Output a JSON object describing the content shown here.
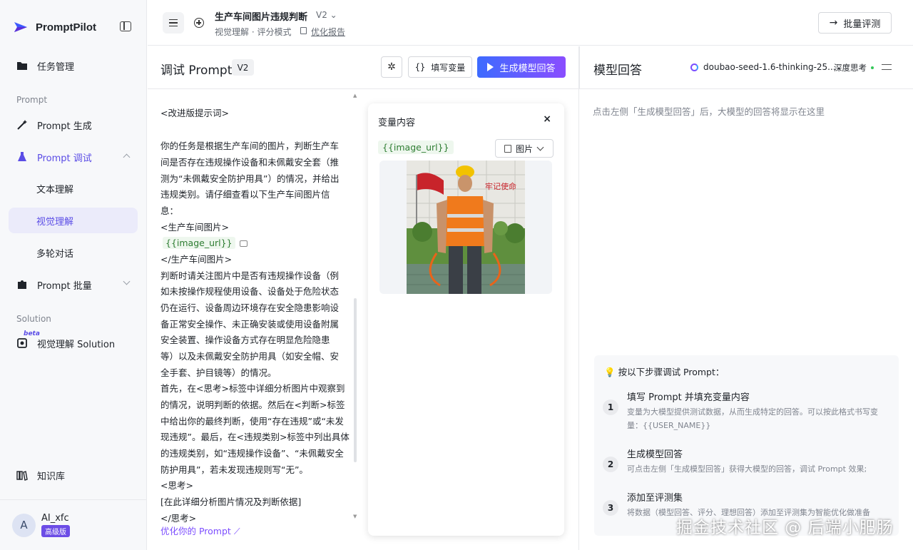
{
  "brand": {
    "name": "PromptPilot"
  },
  "sidebar": {
    "task_mgmt": "任务管理",
    "section_prompt": "Prompt",
    "prompt_gen": "Prompt 生成",
    "prompt_debug": "Prompt 调试",
    "sub_text": "文本理解",
    "sub_vision": "视觉理解",
    "sub_multi": "多轮对话",
    "prompt_batch": "Prompt 批量",
    "section_solution": "Solution",
    "beta": "beta",
    "vision_solution": "视觉理解 Solution",
    "knowledge": "知识库",
    "user": {
      "initial": "A",
      "name": "AI_xfc",
      "plan": "高级版"
    }
  },
  "header": {
    "title": "生产车间图片违规判断",
    "version": "V2 ⌄",
    "subtitle": "视觉理解 · 评分模式",
    "report_link": "优化报告",
    "batch_eval": "批量评测"
  },
  "debug": {
    "title": "调试 Prompt",
    "version_badge": "V2",
    "fill_vars": "填写变量",
    "generate": "生成模型回答"
  },
  "prompt_lines": [
    "<改进版提示词>",
    "",
    "你的任务是根据生产车间的图片，判断生产车",
    "间是否存在违规操作设备和未佩戴安全套（推",
    "测为“未佩戴安全防护用具”）的情况，并给出",
    "违规类别。请仔细查看以下生产车间图片信",
    "息：",
    "<生产车间图片>",
    "{{image_url}}",
    "</生产车间图片>",
    "判断时请关注图片中是否有违规操作设备（例",
    "如未按操作规程使用设备、设备处于危险状态",
    "仍在运行、设备周边环境存在安全隐患影响设",
    "备正常安全操作、未正确安装或使用设备附属",
    "安全装置、操作设备方式存在明显危险隐患",
    "等）以及未佩戴安全防护用具（如安全帽、安",
    "全手套、护目镜等）的情况。",
    "首先，在<思考>标签中详细分析图片中观察到",
    "的情况，说明判断的依据。然后在<判断>标签",
    "中给出你的最终判断，使用“存在违规”或“未发",
    "现违规”。最后，在<违规类别>标签中列出具体",
    "的违规类别，如“违规操作设备”、“未佩戴安全",
    "防护用具”，若未发现违规则写“无”。",
    "<思考>",
    "[在此详细分析图片情况及判断依据]",
    "</思考>"
  ],
  "optimize_link": "优化你的 Prompt",
  "var_panel": {
    "title": "变量内容",
    "close": "×",
    "var_name": "{{image_url}}",
    "type": "图片",
    "poster_text": "牢记使命"
  },
  "answer": {
    "title": "模型回答",
    "model": "doubao-seed-1.6-thinking-25...",
    "deep_think": "深度思考",
    "hint": "点击左侧「生成模型回答」后，大模型的回答将显示在这里"
  },
  "steps": {
    "title": "按以下步骤调试 Prompt：",
    "items": [
      {
        "num": "1",
        "title": "填写 Prompt 并填充变量内容",
        "desc": "变量为大模型提供测试数据，从而生成特定的回答。可以按此格式书写变量：{{USER_NAME}}"
      },
      {
        "num": "2",
        "title": "生成模型回答",
        "desc": "可点击左侧「生成模型回答」获得大模型的回答，调试 Prompt 效果;"
      },
      {
        "num": "3",
        "title": "添加至评测集",
        "desc": "将数据（模型回答、评分、理想回答）添加至评测集为智能优化做准备"
      }
    ]
  },
  "watermark": "掘金技术社区 @ 后端小肥肠",
  "colors": {
    "accent": "#5b4de6",
    "var_green": "#2e7d32",
    "gen_start": "#3d6bff",
    "gen_end": "#8a4dff"
  }
}
